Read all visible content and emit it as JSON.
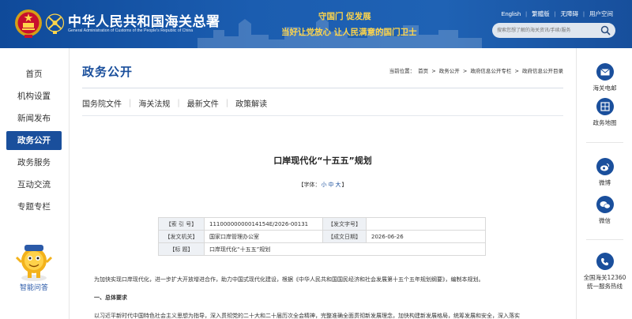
{
  "header": {
    "title_cn": "中华人民共和国海关总署",
    "title_en": "General Administration of Customs of the People's Republic of China",
    "slogan_line1": "守国门  促发展",
    "slogan_line2": "当好让党放心  让人民满意的国门卫士",
    "top_links": [
      "English",
      "繁體版",
      "无障碍",
      "用户空间"
    ],
    "search_placeholder": "搜索您想了解的海关资讯/手续/服务",
    "icons": [
      "national-emblem-icon",
      "customs-key-logo-icon",
      "search-icon"
    ]
  },
  "left_nav": {
    "items": [
      "首页",
      "机构设置",
      "新闻发布",
      "政务公开",
      "政务服务",
      "互动交流",
      "专题专栏"
    ],
    "active_index": 3,
    "assistant_label": "智能问答"
  },
  "main": {
    "section_title": "政务公开",
    "breadcrumb": {
      "prefix": "当前位置：",
      "items": [
        "首页",
        "政务公开",
        "政府信息公开专栏",
        "政府信息公开目录"
      ],
      "separator": ">"
    },
    "sub_tabs": [
      "国务院文件",
      "海关法规",
      "最新文件",
      "政策解读"
    ],
    "article_title": "口岸现代化“十五五”规划",
    "font_size": {
      "prefix": "【字体：",
      "options": [
        "小",
        "中",
        "大"
      ],
      "suffix": "】"
    },
    "meta": {
      "rows": [
        {
          "k1": "【索 引 号】",
          "v1": "11100000000014154E/2026-00131",
          "k2": "【发文字号】",
          "v2": ""
        },
        {
          "k1": "【发文机关】",
          "v1": "国家口岸管理办公室",
          "k2": "【成文日期】",
          "v2": "2026-06-26"
        },
        {
          "k1": "【标      题】",
          "v1": "口岸现代化“十五五”规划"
        }
      ]
    },
    "body": {
      "p1": "为加快实现口岸现代化，进一步扩大开放增进合作，助力中国式现代化建设，根据《中华人民共和国国民经济和社会发展第十五个五年规划纲要》，编制本规划。",
      "h1": "一、总体要求",
      "p2": "以习近平新时代中国特色社会主义思想为指导，深入贯彻党的二十大和二十届历次全会精神，完整准确全面贯彻新发展理念，加快构建新发展格局，统筹发展和安全，深入落实"
    }
  },
  "right_bar": {
    "items": [
      {
        "label": "海关电邮",
        "icon": "mail-icon"
      },
      {
        "label": "政务地图",
        "icon": "map-icon"
      },
      {
        "label": "微博",
        "icon": "weibo-icon"
      },
      {
        "label": "微信",
        "icon": "wechat-icon"
      },
      {
        "label": "全国海关12360",
        "label2": "统一服务热线",
        "icon": "phone-icon"
      }
    ]
  },
  "colors": {
    "brand_blue": "#1a4f9c",
    "header_blue": "#1b5db0",
    "slogan_gold": "#ffd54a"
  }
}
